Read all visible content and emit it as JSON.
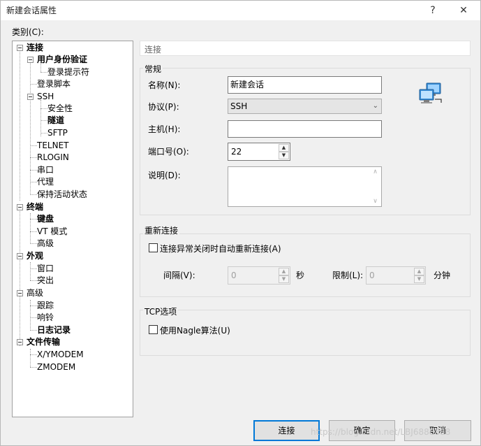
{
  "window": {
    "title": "新建会话属性",
    "help": "?",
    "close": "✕"
  },
  "category_label": "类别(C):",
  "tree": {
    "items": [
      {
        "label": "连接"
      },
      {
        "label": "用户身份验证"
      },
      {
        "label": "登录提示符"
      },
      {
        "label": "登录脚本"
      },
      {
        "label": "SSH"
      },
      {
        "label": "安全性"
      },
      {
        "label": "隧道"
      },
      {
        "label": "SFTP"
      },
      {
        "label": "TELNET"
      },
      {
        "label": "RLOGIN"
      },
      {
        "label": "串口"
      },
      {
        "label": "代理"
      },
      {
        "label": "保持活动状态"
      },
      {
        "label": "终端"
      },
      {
        "label": "键盘"
      },
      {
        "label": "VT 模式"
      },
      {
        "label": "高级"
      },
      {
        "label": "外观"
      },
      {
        "label": "窗口"
      },
      {
        "label": "突出"
      },
      {
        "label": "高级"
      },
      {
        "label": "跟踪"
      },
      {
        "label": "响铃"
      },
      {
        "label": "日志记录"
      },
      {
        "label": "文件传输"
      },
      {
        "label": "X/YMODEM"
      },
      {
        "label": "ZMODEM"
      }
    ]
  },
  "page_header": "连接",
  "general": {
    "title": "常规",
    "name_label": "名称(N):",
    "name_value": "新建会话",
    "protocol_label": "协议(P):",
    "protocol_value": "SSH",
    "host_label": "主机(H):",
    "host_value": "",
    "port_label": "端口号(O):",
    "port_value": "22",
    "desc_label": "说明(D):",
    "desc_value": ""
  },
  "reconnect": {
    "title": "重新连接",
    "auto_label": "连接异常关闭时自动重新连接(A)",
    "interval_label": "间隔(V):",
    "interval_value": "0",
    "interval_unit": "秒",
    "limit_label": "限制(L):",
    "limit_value": "0",
    "limit_unit": "分钟"
  },
  "tcp": {
    "title": "TCP选项",
    "nagle_label": "使用Nagle算法(U)"
  },
  "buttons": {
    "connect": "连接",
    "ok": "确定",
    "cancel": "取消"
  },
  "watermark": "https://blog.csdn.net/LBJ6888888"
}
